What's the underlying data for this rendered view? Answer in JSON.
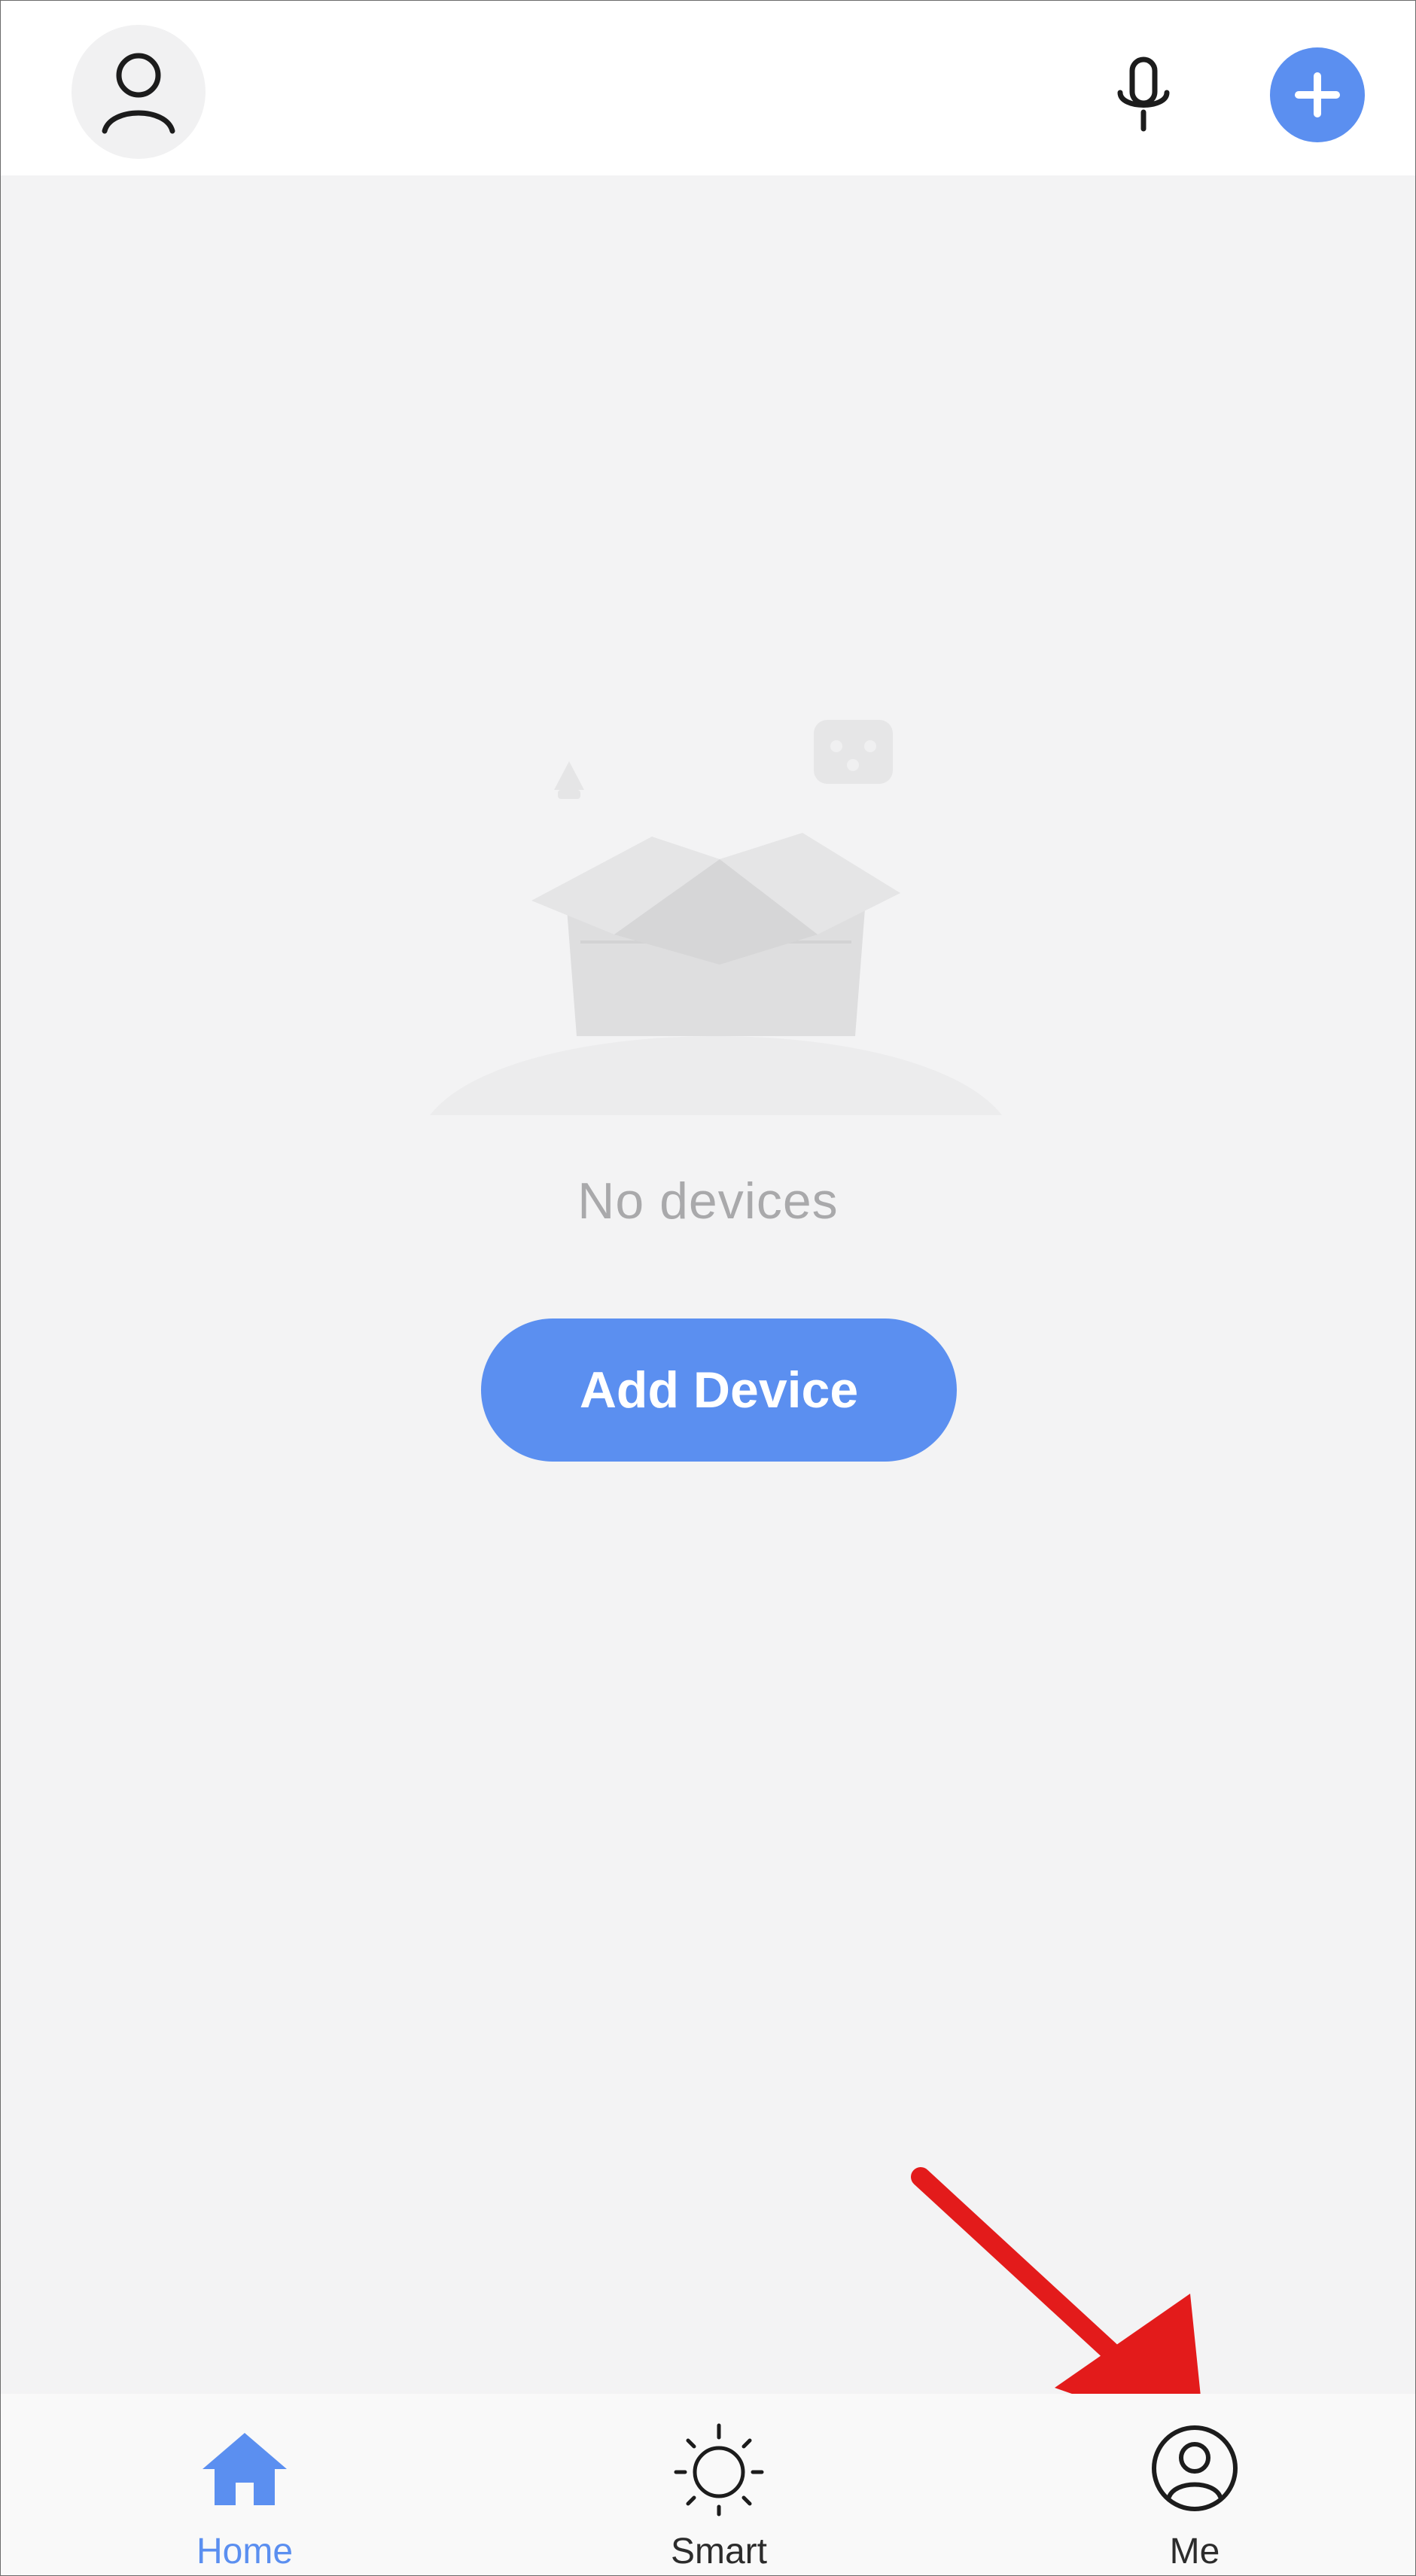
{
  "header": {
    "profile_icon": "person-outline-icon",
    "voice_icon": "microphone-icon",
    "add_icon": "plus-circle-icon"
  },
  "empty_state": {
    "illustration": "empty-open-box-illustration",
    "message": "No devices",
    "button_label": "Add Device"
  },
  "tabs": [
    {
      "label": "Home",
      "icon": "home-icon",
      "active": true
    },
    {
      "label": "Smart",
      "icon": "sun-icon",
      "active": false
    },
    {
      "label": "Me",
      "icon": "user-circle-icon",
      "active": false
    }
  ],
  "annotation": {
    "type": "red-arrow",
    "points_to": "Me"
  },
  "colors": {
    "accent": "#5b8ff0",
    "background": "#f3f3f4",
    "header_background": "#ffffff",
    "empty_text": "#a9a9ab",
    "annotation_arrow": "#e31b1b"
  }
}
